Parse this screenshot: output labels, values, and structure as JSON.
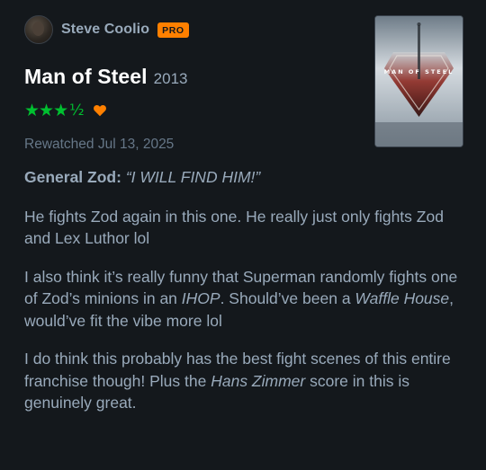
{
  "reviewer": {
    "name": "Steve Coolio",
    "badge": "PRO"
  },
  "film": {
    "title": "Man of Steel",
    "year": "2013",
    "poster_text": "MAN OF STEEL"
  },
  "rating": {
    "stars": "★★★",
    "half": "½",
    "liked": true,
    "star_color": "#00c030",
    "heart_color": "#ff8000"
  },
  "watch_date": "Rewatched Jul 13, 2025",
  "review": {
    "quote_speaker": "General Zod:",
    "quote_text": "“I WILL FIND HIM!”",
    "p1": "He fights Zod again in this one.  He really just only fights Zod and Lex Luthor lol",
    "p2_a": "I also think it’s really funny that Superman randomly fights one of Zod’s minions in an ",
    "p2_b": "IHOP",
    "p2_c": ".  Should’ve been a ",
    "p2_d": "Waffle House",
    "p2_e": ", would’ve fit the vibe more lol",
    "p3_a": "I do think this probably has the best fight scenes of this entire franchise though!  Plus the ",
    "p3_b": "Hans Zimmer",
    "p3_c": " score in this is genuinely great."
  },
  "colors": {
    "background": "#14181c",
    "text": "#99aabb",
    "title": "#ffffff",
    "muted": "#667788"
  }
}
